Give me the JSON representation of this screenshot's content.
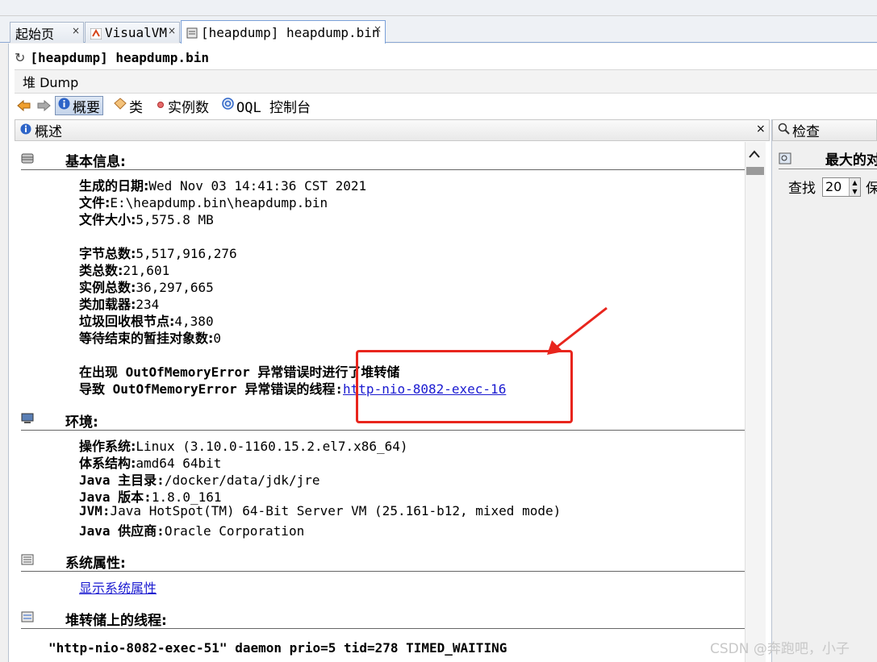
{
  "tabs": [
    {
      "label": "起始页",
      "icon": "start-page-icon"
    },
    {
      "label": "VisualVM",
      "icon": "visualvm-icon"
    },
    {
      "label": "[heapdump] heapdump.bin",
      "icon": "heapdump-icon"
    }
  ],
  "tab_close": "×",
  "document_title": "[heapdump] heapdump.bin",
  "heap_dump_label": "堆 Dump",
  "toolbar": {
    "summary": "概要",
    "classes": "类",
    "instances": "实例数",
    "oql": "OQL 控制台"
  },
  "overview_panel": {
    "title": "概述",
    "close": "×"
  },
  "basic_info": {
    "title": "基本信息:",
    "date_label": "生成的日期:",
    "date_value": "Wed Nov 03 14:41:36 CST 2021",
    "file_label": "文件:",
    "file_value": "E:\\heapdump.bin\\heapdump.bin",
    "size_label": "文件大小:",
    "size_value": "5,575.8 MB",
    "bytes_label": "字节总数:",
    "bytes_value": "5,517,916,276",
    "classes_label": "类总数:",
    "classes_value": "21,601",
    "instances_label": "实例总数:",
    "instances_value": "36,297,665",
    "classloaders_label": "类加载器:",
    "classloaders_value": "234",
    "gcroots_label": "垃圾回收根节点:",
    "gcroots_value": "4,380",
    "pending_label": "等待结束的暂挂对象数:",
    "pending_value": "0",
    "oom_line": "在出现 OutOfMemoryError 异常错误时进行了堆转储",
    "oom_thread_label": "导致 OutOfMemoryError 异常错误的线程:",
    "oom_thread_link": "http-nio-8082-exec-16"
  },
  "environment": {
    "title": "环境:",
    "os_label": "操作系统:",
    "os_value": "Linux (3.10.0-1160.15.2.el7.x86_64)",
    "arch_label": "体系结构:",
    "arch_value": "amd64 64bit",
    "home_label": "Java 主目录:",
    "home_value": "/docker/data/jdk/jre",
    "version_label": "Java 版本:",
    "version_value": "1.8.0_161",
    "jvm_label": "JVM:",
    "jvm_value": "Java HotSpot(TM) 64-Bit Server VM (25.161-b12, mixed mode)",
    "vendor_label": "Java 供应商:",
    "vendor_value": "Oracle Corporation"
  },
  "system_properties": {
    "title": "系统属性:",
    "link": "显示系统属性"
  },
  "threads": {
    "title": "堆转储上的线程:",
    "first_thread": "\"http-nio-8082-exec-51\" daemon prio=5 tid=278 TIMED_WAITING"
  },
  "right_panel": {
    "title": "检查",
    "section": "最大的对",
    "find_label": "查找",
    "find_value": "20",
    "keep_label": "保"
  },
  "watermark": "CSDN @奔跑吧，小子",
  "colors": {
    "annotation": "#e8251d",
    "link": "#1a1ad0"
  }
}
